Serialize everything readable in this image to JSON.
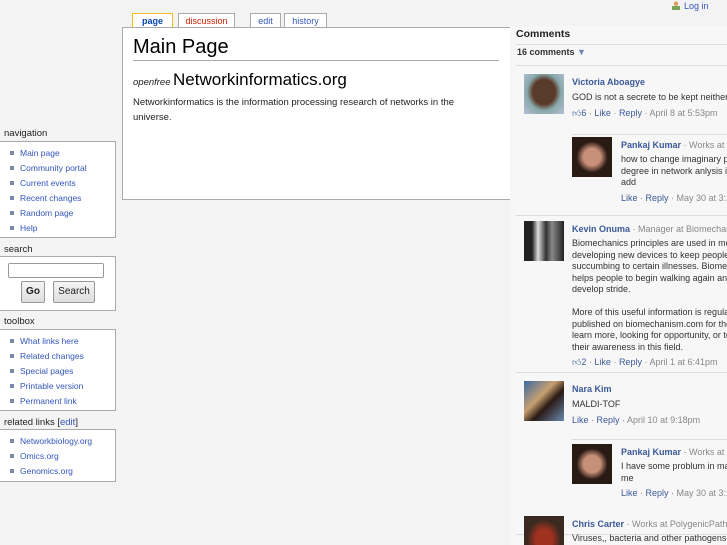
{
  "header": {
    "login": "Log in"
  },
  "tabs": [
    {
      "label": "page"
    },
    {
      "label": "discussion"
    },
    {
      "label": "edit"
    },
    {
      "label": "history"
    }
  ],
  "content": {
    "title": "Main Page",
    "subtitle_prefix": "openfree",
    "subtitle": "Networkinformatics.org",
    "body": "Networkinformatics is the information processing research of networks in the universe."
  },
  "sidebar": {
    "navigation": {
      "title": "navigation",
      "items": [
        "Main page",
        "Community portal",
        "Current events",
        "Recent changes",
        "Random page",
        "Help"
      ]
    },
    "search": {
      "title": "search",
      "value": "",
      "go": "Go",
      "search": "Search"
    },
    "toolbox": {
      "title": "toolbox",
      "items": [
        "What links here",
        "Related changes",
        "Special pages",
        "Printable version",
        "Permanent link"
      ]
    },
    "related": {
      "title": "related links",
      "edit": "edit",
      "items": [
        "Networkbiology.org",
        "Omics.org",
        "Genomics.org"
      ]
    }
  },
  "comments": {
    "title": "Comments",
    "count": "16 comments",
    "items": [
      {
        "name": "Victoria Aboagye",
        "sub": "",
        "lines": [
          "GOD is not a secrete to be kept neither a"
        ],
        "likes": "6",
        "like": "Like",
        "reply": "Reply",
        "time": "April 8 at 5:53pm"
      },
      {
        "name": "Pankaj Kumar",
        "sub": "Works at S",
        "lines": [
          "how to change imaginary pa",
          "degree in network anlysis in",
          "add"
        ],
        "like": "Like",
        "reply": "Reply",
        "time": "May 30 at 3:17"
      },
      {
        "name": "Kevin Onuma",
        "sub": "Manager at Biomechani",
        "lines": [
          "Biomechanics principles are used in med",
          "developing new devices to keep people f",
          "succumbing to certain illnesses. Biomec",
          "helps people to begin walking again and a",
          "develop stride.",
          "",
          "More of this useful information is regularl",
          "published on biomechanism.com for thos",
          "learn more, looking for opportunity, or to",
          "their awareness in this field."
        ],
        "likes": "2",
        "like": "Like",
        "reply": "Reply",
        "time": "April 1 at 6:41pm"
      },
      {
        "name": "Nara Kim",
        "sub": "",
        "lines": [
          "MALDI-TOF"
        ],
        "like": "Like",
        "reply": "Reply",
        "time": "April 10 at 9:18pm"
      },
      {
        "name": "Pankaj Kumar",
        "sub": "Works at S",
        "lines": [
          "I have some problum in mat",
          "me"
        ],
        "like": "Like",
        "reply": "Reply",
        "time": "May 30 at 3:1"
      },
      {
        "name": "Chris Carter",
        "sub": "Works at PolygenicPathw",
        "lines": [
          "Viruses,, bacteria and other pathogens h"
        ]
      }
    ]
  },
  "colors": {
    "link": "#3355bb",
    "fb_link": "#3b5998",
    "tab_sel": "#fabd23",
    "discussion": "#cc2200"
  }
}
